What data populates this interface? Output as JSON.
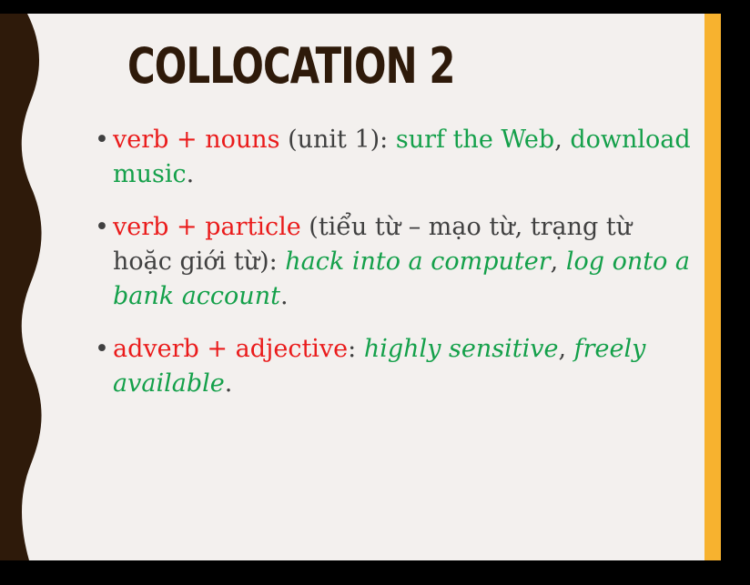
{
  "slide": {
    "title": "COLLOCATION 2",
    "bullets": [
      {
        "symbol": "•",
        "parts": [
          {
            "text": "verb + nouns",
            "color": "red"
          },
          {
            "text": " (unit 1): ",
            "color": "gray"
          },
          {
            "text": "surf the Web",
            "color": "green"
          },
          {
            "text": ", ",
            "color": "gray"
          },
          {
            "text": "download music",
            "color": "green"
          },
          {
            "text": ".",
            "color": "gray"
          }
        ]
      },
      {
        "symbol": "•",
        "parts": [
          {
            "text": "verb + particle",
            "color": "red"
          },
          {
            "text": " (tiểu từ – mạo từ, trạng từ hoặc giới từ): ",
            "color": "gray"
          },
          {
            "text": "hack into a computer",
            "color": "green",
            "italic": true
          },
          {
            "text": ", ",
            "color": "gray"
          },
          {
            "text": "log onto a bank account",
            "color": "green",
            "italic": true
          },
          {
            "text": ".",
            "color": "gray"
          }
        ]
      },
      {
        "symbol": "•",
        "parts": [
          {
            "text": "adverb + adjective",
            "color": "red"
          },
          {
            "text": ": ",
            "color": "gray"
          },
          {
            "text": "highly sensitive",
            "color": "green",
            "italic": true
          },
          {
            "text": ", ",
            "color": "gray"
          },
          {
            "text": "freely available",
            "color": "green",
            "italic": true
          },
          {
            "text": ".",
            "color": "gray"
          }
        ]
      }
    ]
  },
  "colors": {
    "background": "#f3f0ee",
    "wave": "#2e1a0a",
    "accent_bar": "#f7b22f",
    "red": "#ea1b1b",
    "green": "#14a04a",
    "gray": "#404040"
  }
}
